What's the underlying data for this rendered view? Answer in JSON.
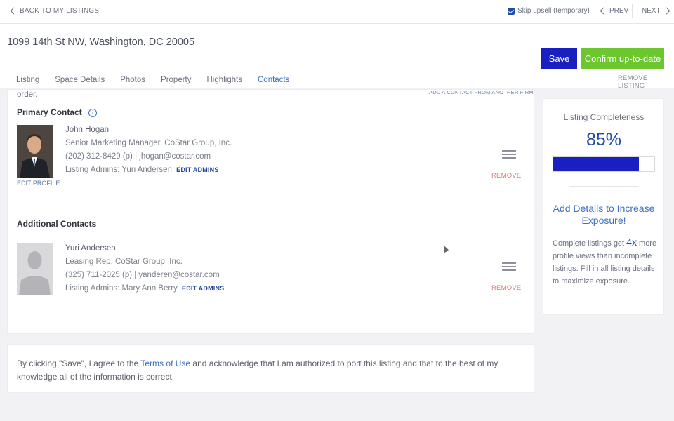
{
  "topbar": {
    "back_label": "BACK TO MY LISTINGS",
    "skip_label": "Skip upsell (temporary)",
    "skip_checked": true,
    "prev_label": "PREV",
    "next_label": "NEXT"
  },
  "header": {
    "address": "1099 14th St NW, Washington, DC 20005",
    "save_label": "Save",
    "confirm_label": "Confirm up-to-date",
    "remove_listing_label": "REMOVE LISTING",
    "tabs": [
      {
        "label": "Listing"
      },
      {
        "label": "Space Details"
      },
      {
        "label": "Photos"
      },
      {
        "label": "Property"
      },
      {
        "label": "Highlights"
      },
      {
        "label": "Contacts"
      }
    ],
    "active_tab": "Contacts"
  },
  "contacts": {
    "order_text": "order.",
    "add_contact_label": "ADD A CONTACT FROM ANOTHER FIRM",
    "primary_title": "Primary Contact",
    "edit_profile_label": "EDIT PROFILE",
    "primary": {
      "name": "John Hogan",
      "title": "Senior Marketing Manager, CoStar Group, Inc.",
      "contact": "(202) 312-8429 (p) | jhogan@costar.com",
      "admins": "Listing Admins: Yuri Andersen",
      "edit_admins_label": "EDIT ADMINS",
      "remove_label": "REMOVE"
    },
    "additional_title": "Additional Contacts",
    "additional": [
      {
        "name": "Yuri Andersen",
        "title": "Leasing Rep, CoStar Group, Inc.",
        "contact": "(325) 711-2025 (p) | yanderen@costar.com",
        "admins": "Listing Admins: Mary Ann Berry",
        "edit_admins_label": "EDIT ADMINS",
        "remove_label": "REMOVE"
      }
    ]
  },
  "sidebar": {
    "completeness_title": "Listing Completeness",
    "completeness_percent": 85,
    "completeness_text": "85%",
    "headline": "Add Details to Increase Exposure!",
    "body_pre": "Complete listings get ",
    "body_highlight": "4x",
    "body_post": " more profile views than incomplete listings. Fill in all listing details to maximize exposure."
  },
  "agreement": {
    "pre": "By clicking \"Save\", I agree to the ",
    "terms_label": "Terms of Use",
    "post": " and acknowledge that I am authorized to port this listing and that to the best of my knowledge all of the information is correct."
  },
  "colors": {
    "save": "#1a1fc0",
    "confirm": "#6cc62e",
    "accent": "#3d6fc2",
    "remove": "#e07a73"
  }
}
